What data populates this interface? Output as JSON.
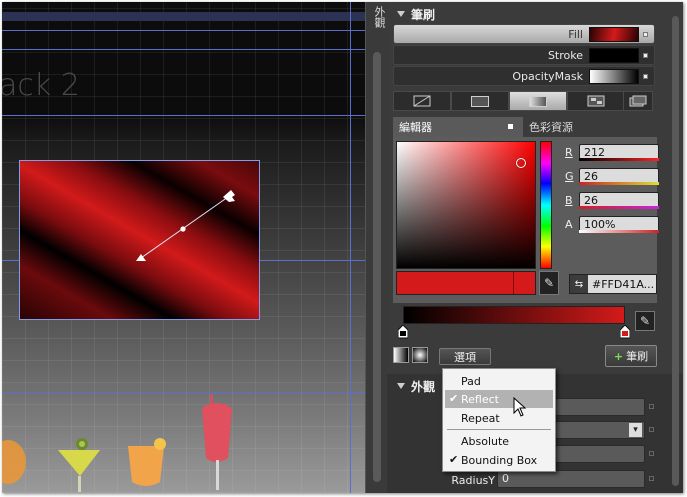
{
  "artboard": {
    "title_fragment": "ack 2"
  },
  "side_tab": {
    "label": "外觀"
  },
  "brush": {
    "header": "筆刷",
    "rows": [
      {
        "label": "Fill",
        "selected": true
      },
      {
        "label": "Stroke",
        "selected": false
      },
      {
        "label": "OpacityMask",
        "selected": false
      }
    ],
    "tabs": [
      "no-brush",
      "solid",
      "gradient",
      "tile",
      "resource"
    ]
  },
  "editor": {
    "tab_editor": "編輯器",
    "tab_resources": "色彩資源",
    "r_label": "R",
    "g_label": "G",
    "b_label": "B",
    "a_label": "A",
    "r": "212",
    "g": "26",
    "b": "26",
    "a": "100%",
    "hex": "#FFD41A...",
    "current_color": "#d41a1a"
  },
  "gradient": {
    "stop_start": "#000000",
    "stop_end": "#d41a1a",
    "options_label": "選項",
    "add_brush_label": "筆刷"
  },
  "appearance": {
    "header": "外觀",
    "radiusy_label": "RadiusY",
    "radiusy_value": "0"
  },
  "menu": {
    "items": [
      {
        "label": "Pad",
        "checked": false,
        "highlighted": false
      },
      {
        "label": "Reflect",
        "checked": true,
        "highlighted": true
      },
      {
        "label": "Repeat",
        "checked": false,
        "highlighted": false
      },
      {
        "label": "Absolute",
        "checked": false,
        "highlighted": false
      },
      {
        "label": "Bounding Box",
        "checked": true,
        "highlighted": false
      }
    ]
  }
}
